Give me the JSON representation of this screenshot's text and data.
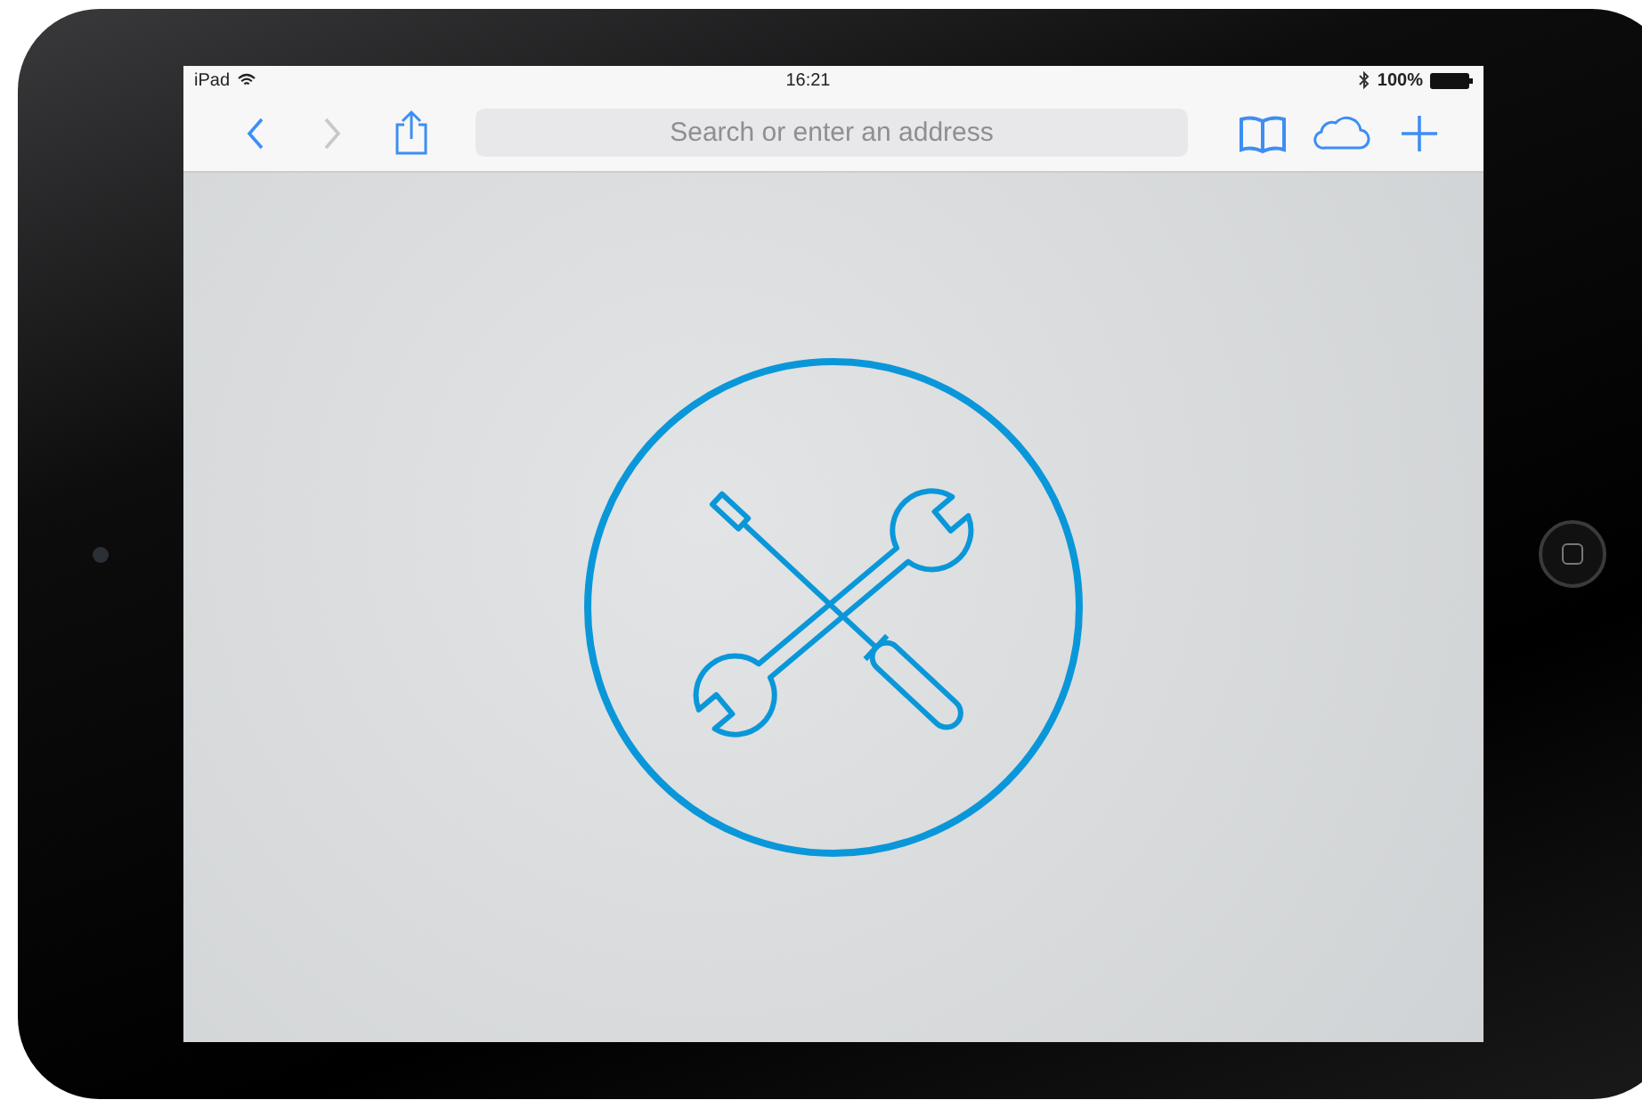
{
  "status_bar": {
    "device": "iPad",
    "time": "16:21",
    "battery": "100%"
  },
  "toolbar": {
    "buttons": [
      {
        "kind": "back",
        "disabled": false
      },
      {
        "kind": "forward",
        "disabled": true
      },
      {
        "kind": "share",
        "disabled": false
      }
    ],
    "address": {
      "placeholder": "Search or enter an address"
    },
    "right_buttons": [
      {
        "kind": "bookmarks",
        "disabled": false
      },
      {
        "kind": "cloud",
        "disabled": false
      },
      {
        "kind": "add",
        "disabled": false
      }
    ]
  }
}
